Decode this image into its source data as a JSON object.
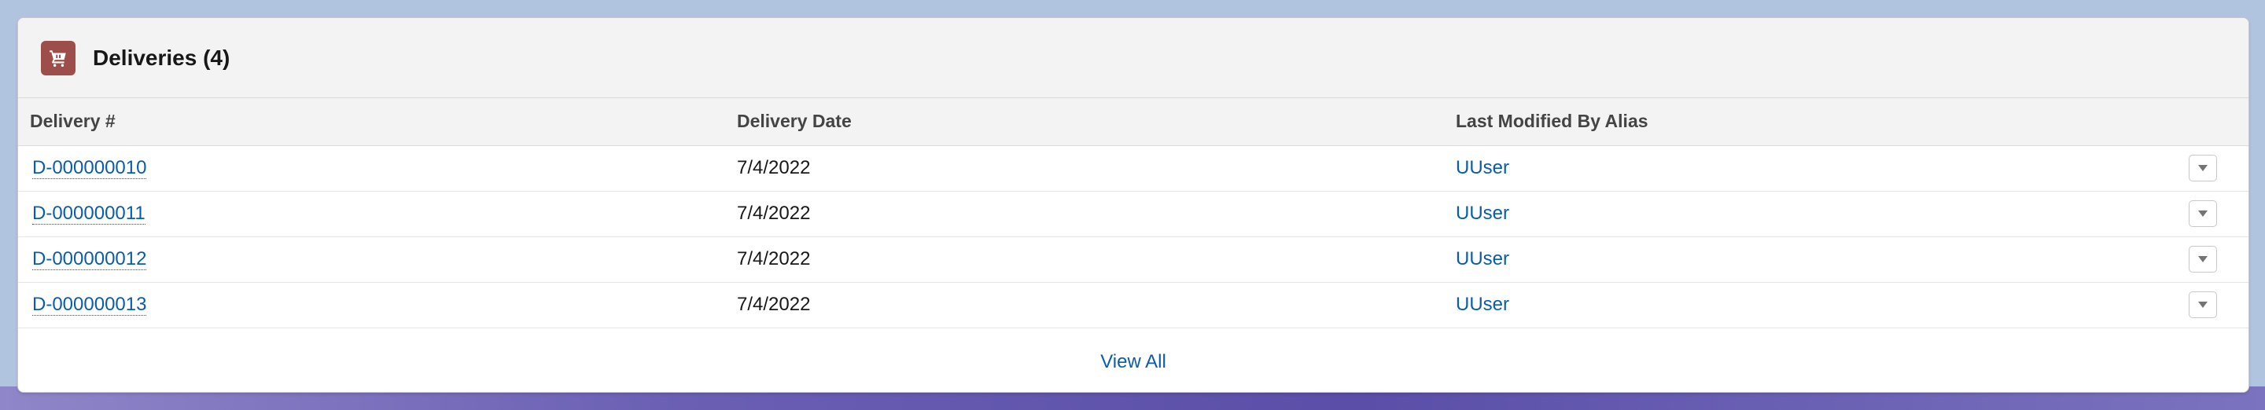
{
  "card": {
    "title": "Deliveries (4)",
    "icon": "cart-icon",
    "icon_color": "#9e4e4a"
  },
  "table": {
    "columns": [
      "Delivery #",
      "Delivery Date",
      "Last Modified By Alias"
    ],
    "rows": [
      {
        "delivery_number": "D-000000010",
        "delivery_date": "7/4/2022",
        "modified_by": "UUser"
      },
      {
        "delivery_number": "D-000000011",
        "delivery_date": "7/4/2022",
        "modified_by": "UUser"
      },
      {
        "delivery_number": "D-000000012",
        "delivery_date": "7/4/2022",
        "modified_by": "UUser"
      },
      {
        "delivery_number": "D-000000013",
        "delivery_date": "7/4/2022",
        "modified_by": "UUser"
      }
    ],
    "row_action_icon": "chevron-down-icon"
  },
  "footer": {
    "view_all_label": "View All"
  },
  "colors": {
    "link": "#0b5cab",
    "header_bg": "#f3f3f3",
    "page_bg": "#b0c4df"
  }
}
